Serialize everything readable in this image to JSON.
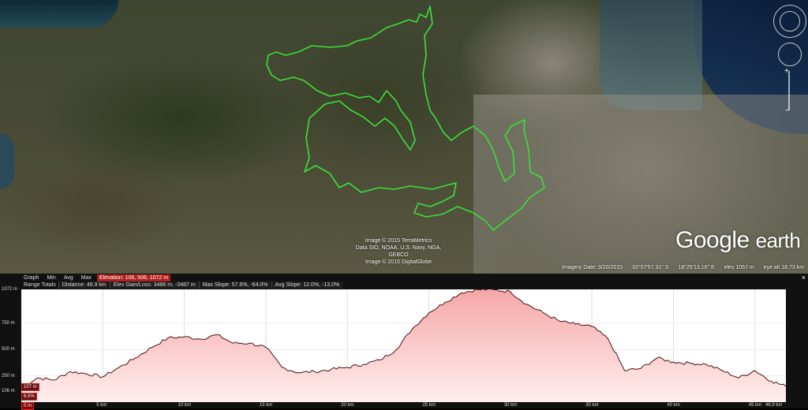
{
  "map": {
    "credits": [
      "Image © 2015 TerraMetrics",
      "Data SIO, NOAA, U.S. Navy, NGA, GEBCO",
      "Image © 2015 DigitalGlobe"
    ],
    "logo_google": "Google",
    "logo_earth": "earth",
    "status": {
      "imagery_date": "Imagery Date: 3/20/2015",
      "lat": "33°57'57.31\" S",
      "lon": "18°25'13.16\" E",
      "elev": "elev  1057 m",
      "eye_alt": "eye alt  18.73 km"
    },
    "track_color": "#39e03a"
  },
  "profile": {
    "row1": {
      "graph": "Graph",
      "min": "Min",
      "avg": "Avg",
      "max": "Max",
      "elevation": "Elevation: 106, 506, 1072 m"
    },
    "row2": {
      "range_totals": "Range Totals",
      "distance": "Distance: 46.9 km",
      "elev_gain": "Elev Gain/Loss: 3486 m, -3487 m",
      "max_slope": "Max Slope: 57.6%, -64.0%",
      "avg_slope": "Avg Slope: 12.0%, -13.0%"
    },
    "close": "×",
    "marker_elev": "107 m",
    "marker_slope": "6.5%",
    "marker_zero": "0 m",
    "fill_top": "#f6a6a6",
    "fill_bottom": "#ffeeee",
    "line_color": "#4a1010"
  },
  "chart_data": {
    "type": "area",
    "xlabel": "",
    "ylabel": "",
    "x_ticks": [
      "5 km",
      "10 km",
      "15 km",
      "20 km",
      "25 km",
      "30 km",
      "35 km",
      "40 km",
      "45 km",
      "46.9 km"
    ],
    "y_ticks": [
      "1072 m",
      "750 m",
      "500 m",
      "250 m",
      "106 m"
    ],
    "xlim": [
      0,
      46.9
    ],
    "ylim": [
      0,
      1072
    ],
    "x": [
      0,
      1,
      2,
      3,
      4,
      5,
      6,
      7,
      8,
      9,
      10,
      11,
      12,
      13,
      14,
      15,
      16,
      17,
      18,
      19,
      20,
      21,
      22,
      23,
      24,
      25,
      26,
      27,
      28,
      29,
      30,
      31,
      32,
      33,
      34,
      35,
      36,
      37,
      38,
      39,
      40,
      41,
      42,
      43,
      44,
      45,
      46,
      46.9
    ],
    "y": [
      140,
      230,
      210,
      290,
      270,
      240,
      330,
      420,
      520,
      610,
      620,
      600,
      640,
      560,
      560,
      520,
      330,
      280,
      290,
      310,
      330,
      360,
      400,
      500,
      700,
      850,
      950,
      1040,
      1070,
      1068,
      1050,
      930,
      850,
      770,
      740,
      720,
      600,
      300,
      320,
      420,
      380,
      370,
      360,
      300,
      230,
      300,
      200,
      150
    ]
  }
}
